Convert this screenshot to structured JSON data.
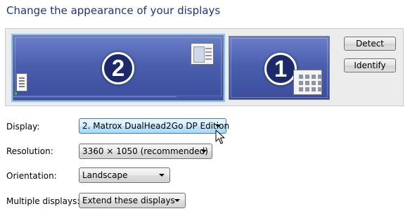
{
  "title": "Change the appearance of your displays",
  "monitors": [
    {
      "number": "2",
      "selected": true
    },
    {
      "number": "1",
      "selected": false
    }
  ],
  "buttons": {
    "detect": "Detect",
    "identify": "Identify"
  },
  "settings": {
    "display": {
      "label": "Display:",
      "value": "2. Matrox DualHead2Go DP Edition"
    },
    "resolution": {
      "label": "Resolution:",
      "value": "3360 × 1050 (recommended)"
    },
    "orientation": {
      "label": "Orientation:",
      "value": "Landscape"
    },
    "multiple_displays": {
      "label": "Multiple displays:",
      "value": "Extend these displays"
    }
  },
  "colors": {
    "title": "#1e3287",
    "monitor_fill": "#4b5fae",
    "selection_glow": "#8fc4ea"
  }
}
